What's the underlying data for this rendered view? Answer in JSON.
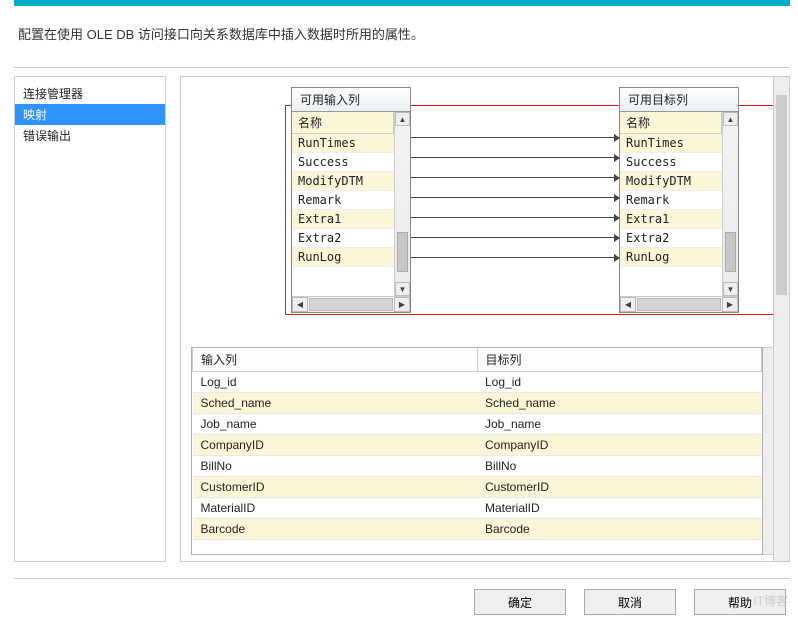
{
  "description": "配置在使用 OLE DB 访问接口向关系数据库中插入数据时所用的属性。",
  "sidebar": {
    "items": [
      {
        "label": "连接管理器",
        "active": false
      },
      {
        "label": "映射",
        "active": true
      },
      {
        "label": "错误输出",
        "active": false
      }
    ]
  },
  "input_list": {
    "title": "可用输入列",
    "name_header": "名称",
    "items": [
      "RunTimes",
      "Success",
      "ModifyDTM",
      "Remark",
      "Extra1",
      "Extra2",
      "RunLog"
    ]
  },
  "target_list": {
    "title": "可用目标列",
    "name_header": "名称",
    "items": [
      "RunTimes",
      "Success",
      "ModifyDTM",
      "Remark",
      "Extra1",
      "Extra2",
      "RunLog"
    ]
  },
  "grid": {
    "col1_header": "输入列",
    "col2_header": "目标列",
    "rows": [
      {
        "in": "Log_id",
        "out": "Log_id"
      },
      {
        "in": "Sched_name",
        "out": "Sched_name"
      },
      {
        "in": "Job_name",
        "out": "Job_name"
      },
      {
        "in": "CompanyID",
        "out": "CompanyID"
      },
      {
        "in": "BillNo",
        "out": "BillNo"
      },
      {
        "in": "CustomerID",
        "out": "CustomerID"
      },
      {
        "in": "MaterialID",
        "out": "MaterialID"
      },
      {
        "in": "Barcode",
        "out": "Barcode"
      }
    ]
  },
  "buttons": {
    "ok": "确定",
    "cancel": "取消",
    "help": "帮助"
  },
  "watermark": "IT博客"
}
